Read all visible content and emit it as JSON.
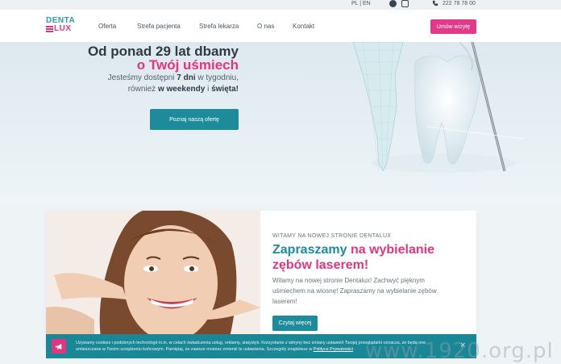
{
  "topbar": {
    "lang": "PL | EN",
    "phone": "222 78 78 00"
  },
  "nav": {
    "logo_line1": "DENTA",
    "logo_line2": "LUX",
    "items": [
      "Oferta",
      "Strefa pacjenta",
      "Strefa lekarza",
      "O nas",
      "Kontakt"
    ],
    "cta": "Umów wizytę"
  },
  "hero": {
    "line1": "Od ponad 29 lat dbamy",
    "line2": "o Twój uśmiech",
    "sub_prefix": "Jesteśmy dostępni ",
    "sub_bold1": "7 dni",
    "sub_mid": " w tygodniu,",
    "sub_line2_prefix": "również ",
    "sub_bold2": "w weekendy",
    "sub_and": " i ",
    "sub_bold3": "święta!",
    "button": "Poznaj naszą ofertę"
  },
  "promo": {
    "eyebrow": "WITAMY NA NOWEJ STRONIE DENTALUX",
    "title_teal": "Zapraszamy",
    "title_pink": " na wybielanie zębów laserem!",
    "description": "Witamy na nowej stronie Dentalux! Zachwyć pięknym uśmiechem na wiosnę! Zapraszamy na wybielanie zębów laserem!",
    "button": "Czytaj więcej"
  },
  "cookie": {
    "text_line1": "Używamy cookies i podobnych technologii m.in. w celach świadczenia usług, reklamy, statystyk. Korzystanie z witryny bez zmiany ustawień Twojej przeglądarki oznacza, że będą one",
    "text_line2": "umieszczane w Twoim urządzeniu końcowym. Pamiętaj, że zawsze możesz zmienić te ustawienia. Szczegóły znajdziesz w ",
    "link": "Polityce Prywatności",
    "close": "×"
  },
  "watermark": "www.1920.org.pl",
  "colors": {
    "teal": "#1e8b9a",
    "pink": "#e0367f"
  }
}
